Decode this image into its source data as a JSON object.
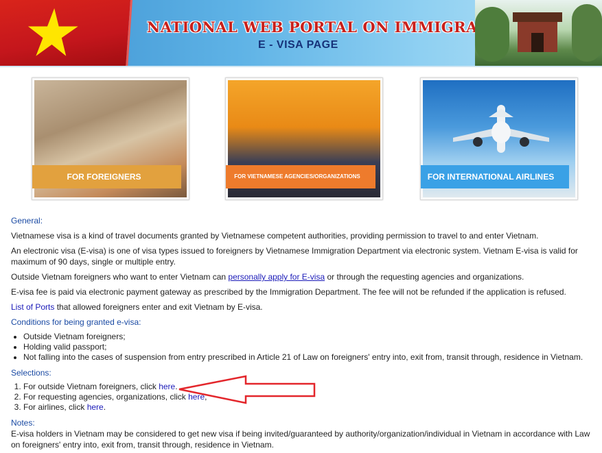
{
  "header": {
    "title": "NATIONAL WEB PORTAL ON IMMIGRATION",
    "subtitle": "E - VISA PAGE"
  },
  "tiles": [
    {
      "label": "FOR FOREIGNERS"
    },
    {
      "label": "FOR VIETNAMESE AGENCIES/ORGANIZATIONS"
    },
    {
      "label": "FOR INTERNATIONAL AIRLINES"
    }
  ],
  "general": {
    "heading": "General:",
    "p1": "Vietnamese visa is a kind of travel documents granted by Vietnamese competent authorities, providing permission to travel to and enter Vietnam.",
    "p2": "An electronic visa (E-visa) is one of visa types issued to foreigners by Vietnamese Immigration Department via electronic system. Vietnam E-visa is valid for maximum of 90 days, single or multiple entry.",
    "p3_before": "Outside Vietnam foreigners who want to enter Vietnam can ",
    "p3_link": "personally apply for E-visa",
    "p3_after": " or through the requesting agencies and organizations.",
    "p4": "E-visa fee is paid via electronic payment gateway as prescribed by the Immigration Department. The fee will not be refunded if the application is refused.",
    "p5_link": "List of Ports",
    "p5_after": " that allowed foreigners enter and exit Vietnam by E-visa."
  },
  "conditions": {
    "heading": "Conditions for being granted e-visa:",
    "items": [
      "Outside Vietnam foreigners;",
      "Holding valid passport;",
      "Not falling into the cases of suspension from entry prescribed in Article 21 of Law on foreigners' entry into, exit from, transit through, residence in Vietnam."
    ]
  },
  "selections": {
    "heading": "Selections:",
    "items": [
      {
        "text": "For outside Vietnam foreigners, click ",
        "link": "here",
        "end": "."
      },
      {
        "text": "For requesting agencies, organizations, click ",
        "link": "here",
        "end": ","
      },
      {
        "text": "For airlines, click ",
        "link": "here",
        "end": "."
      }
    ]
  },
  "notes": {
    "heading": "Notes:",
    "text": "E-visa holders in Vietnam may be considered to get new visa if being invited/guaranteed by authority/organization/individual in Vietnam in accordance with Law on foreigners' entry into, exit from, transit through, residence in Vietnam."
  },
  "colors": {
    "flag_red": "#c4161c",
    "title_red": "#c8201b",
    "heading_blue": "#1a4aa3",
    "annotation_arrow": "#e3262b"
  }
}
